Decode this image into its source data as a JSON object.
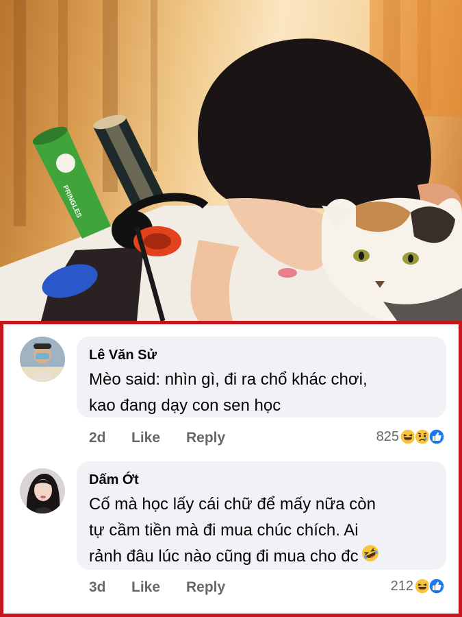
{
  "comments": [
    {
      "author": "Lê Văn Sử",
      "text": "Mèo said: nhìn gì, đi ra chổ khác chơi,\nkao đang dạy con sen học",
      "time": "2d",
      "like_label": "Like",
      "reply_label": "Reply",
      "reaction_count": "825",
      "reaction_icons": [
        "laughing-emoji-icon",
        "sad-emoji-icon",
        "like-thumb-icon"
      ]
    },
    {
      "author": "Dấm Ớt",
      "text": "Cố mà học lấy cái chữ để mấy nữa còn\ntự cầm tiền mà đi mua chúc chích. Ai\nrảnh đâu lúc nào cũng đi mua cho đc",
      "text_trailing_icon": "rolling-laughing-emoji-icon",
      "time": "3d",
      "like_label": "Like",
      "reply_label": "Reply",
      "reaction_count": "212",
      "reaction_icons": [
        "laughing-emoji-icon",
        "like-thumb-icon"
      ]
    }
  ],
  "colors": {
    "frame_border": "#c4161c",
    "bubble_bg": "#f0f2f5",
    "meta_text": "#65676b",
    "like_blue": "#1877f2"
  },
  "photo": {
    "can_brand_label": "PRINGLES"
  }
}
